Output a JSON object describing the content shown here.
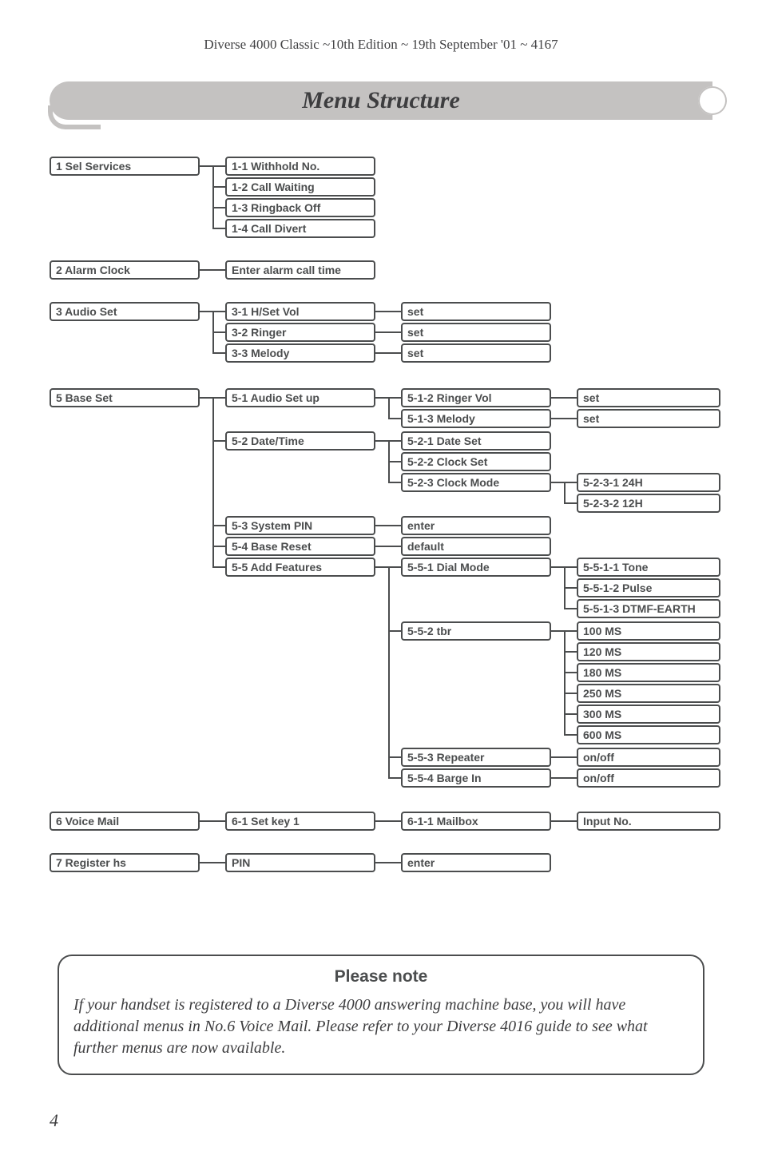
{
  "header": "Diverse 4000 Classic ~10th Edition ~ 19th September '01 ~ 4167",
  "title": "Menu Structure",
  "page_number": "4",
  "note": {
    "title": "Please note",
    "body": "If your handset is registered to a Diverse 4000 answering machine base, you will have additional menus in No.6 Voice Mail. Please refer to your Diverse 4016 guide to see what further menus are now available."
  },
  "menu": {
    "r1": {
      "main": "1 Sel Services",
      "a": "1-1 Withhold No.",
      "b": "1-2 Call Waiting",
      "c": "1-3 Ringback Off",
      "d": "1-4 Call Divert"
    },
    "r2": {
      "main": "2 Alarm Clock",
      "a": "Enter alarm call time"
    },
    "r3": {
      "main": "3 Audio Set",
      "a": "3-1 H/Set Vol",
      "a_v": "set",
      "b": "3-2 Ringer",
      "b_v": "set",
      "c": "3-3 Melody",
      "c_v": "set"
    },
    "r5": {
      "main": "5 Base Set",
      "a": "5-1 Audio Set up",
      "a1": "5-1-2 Ringer Vol",
      "a1v": "set",
      "a2": "5-1-3 Melody",
      "a2v": "set",
      "b": "5-2 Date/Time",
      "b1": "5-2-1 Date Set",
      "b2": "5-2-2 Clock Set",
      "b3": "5-2-3 Clock Mode",
      "b3a": "5-2-3-1 24H",
      "b3b": "5-2-3-2 12H",
      "c": "5-3 System PIN",
      "c1": "enter",
      "d": "5-4 Base Reset",
      "d1": "default",
      "e": "5-5 Add Features",
      "e1": "5-5-1 Dial Mode",
      "e1a": "5-5-1-1 Tone",
      "e1b": "5-5-1-2 Pulse",
      "e1c": "5-5-1-3 DTMF-EARTH",
      "e2": "5-5-2 tbr",
      "e2a": "100 MS",
      "e2b": "120 MS",
      "e2c": "180 MS",
      "e2d": "250 MS",
      "e2e": "300 MS",
      "e2f": "600 MS",
      "e3": "5-5-3 Repeater",
      "e3v": "on/off",
      "e4": "5-5-4 Barge In",
      "e4v": "on/off"
    },
    "r6": {
      "main": "6 Voice Mail",
      "a": "6-1 Set key 1",
      "b": "6-1-1 Mailbox",
      "c": "Input No."
    },
    "r7": {
      "main": "7 Register hs",
      "a": "PIN",
      "b": "enter"
    }
  }
}
